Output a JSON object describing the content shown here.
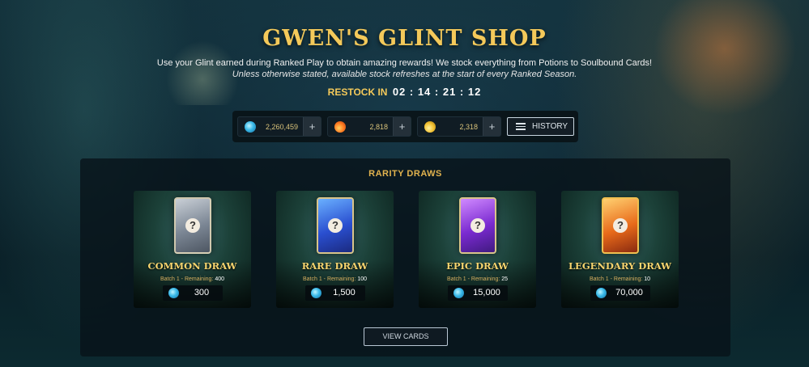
{
  "header": {
    "title": "GWEN'S GLINT SHOP",
    "description": "Use your Glint earned during Ranked Play to obtain amazing rewards! We stock everything from Potions to Soulbound Cards!",
    "note": "Unless otherwise stated, available stock refreshes at the start of every Ranked Season.",
    "restock_label": "RESTOCK IN",
    "restock_time": "02 : 14 : 21 : 12"
  },
  "currencies": [
    {
      "icon": "glint-icon",
      "value": "2,260,459",
      "plus": "+"
    },
    {
      "icon": "red-potion-icon",
      "value": "2,818",
      "plus": "+"
    },
    {
      "icon": "gold-potion-icon",
      "value": "2,318",
      "plus": "+"
    }
  ],
  "history_button": "HISTORY",
  "rarity_draws": {
    "title": "RARITY DRAWS",
    "items": [
      {
        "name": "COMMON DRAW",
        "batch": "Batch 1 - Remaining:",
        "remaining": "400",
        "price": "300"
      },
      {
        "name": "RARE DRAW",
        "batch": "Batch 1 - Remaining:",
        "remaining": "100",
        "price": "1,500"
      },
      {
        "name": "EPIC DRAW",
        "batch": "Batch 1 - Remaining:",
        "remaining": "25",
        "price": "15,000"
      },
      {
        "name": "LEGENDARY DRAW",
        "batch": "Batch 1 - Remaining:",
        "remaining": "10",
        "price": "70,000"
      }
    ],
    "view_button": "VIEW CARDS"
  },
  "colors": {
    "accent_gold": "#f4c95a",
    "panel_title": "#e2b34e"
  }
}
